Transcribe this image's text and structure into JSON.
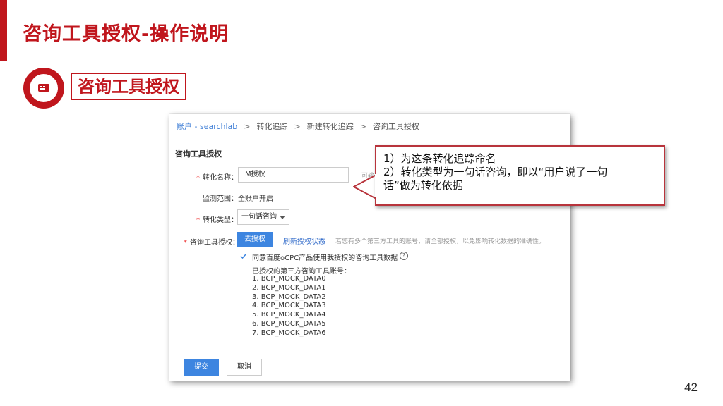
{
  "slide": {
    "title": "咨询工具授权-操作说明",
    "section_label": "咨询工具授权",
    "page_number": "42"
  },
  "colors": {
    "accent": "#c0161d",
    "primary_button": "#3d85e0",
    "link": "#2a66c8"
  },
  "breadcrumb": {
    "items": [
      "账户 - searchlab",
      "转化追踪",
      "新建转化追踪",
      "咨询工具授权"
    ],
    "separator": ">"
  },
  "form": {
    "title": "咨询工具授权",
    "name_label": "转化名称：",
    "name_value": "IM授权",
    "name_hint_truncated": "可输",
    "scope_label": "监测范围：",
    "scope_value": "全账户开启",
    "type_label": "转化类型：",
    "type_selected": "一句话咨询",
    "auth_label": "咨询工具授权：",
    "auth_button": "去授权",
    "refresh_link": "刷新授权状态",
    "auth_hint": "若您有多个第三方工具的账号，请全部授权，以免影响转化数据的准确性。",
    "agree_checked": true,
    "agree_text": "同意百度oCPC产品使用我授权的咨询工具数据",
    "help_icon": "question-circle-icon",
    "accounts_title": "已授权的第三方咨询工具账号：",
    "accounts": [
      "1. BCP_MOCK_DATA0",
      "2. BCP_MOCK_DATA1",
      "3. BCP_MOCK_DATA2",
      "4. BCP_MOCK_DATA3",
      "5. BCP_MOCK_DATA4",
      "6. BCP_MOCK_DATA5",
      "7. BCP_MOCK_DATA6"
    ],
    "submit_label": "提交",
    "cancel_label": "取消"
  },
  "callout": {
    "line1": "1）为这条转化追踪命名",
    "line2": "2）转化类型为一句话咨询，即以“用户说了一句",
    "line3": "话”做为转化依据"
  }
}
